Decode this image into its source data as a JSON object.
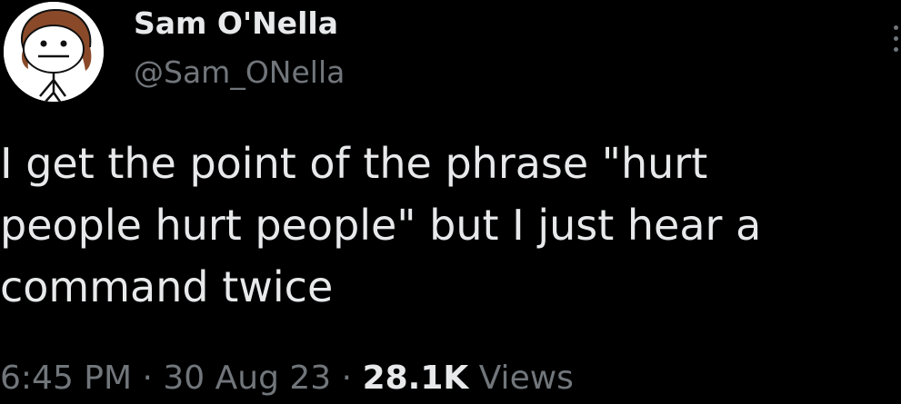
{
  "author": {
    "display_name": "Sam O'Nella",
    "handle": "@Sam_ONella",
    "avatar_icon": "stick-figure-avatar-icon"
  },
  "tweet": {
    "line1": "I get the point of the phrase \"hurt",
    "line2": "people hurt people\" but I just hear a",
    "line3": "command twice"
  },
  "meta": {
    "time": "6:45 PM",
    "sep1": " · ",
    "date": "30 Aug 23",
    "sep2": " · ",
    "views_count": "28.1K",
    "views_label": " Views"
  },
  "menu": {
    "icon": "more-vertical-icon"
  },
  "colors": {
    "background": "#000000",
    "primary_text": "#e7e9ea",
    "secondary_text": "#71767b"
  }
}
